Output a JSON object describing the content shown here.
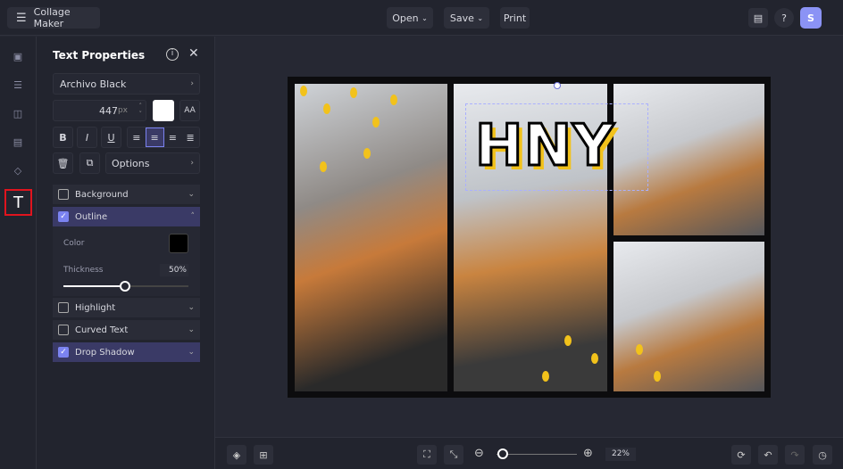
{
  "app": {
    "title": "Collage Maker",
    "menu": [
      "Open",
      "Save",
      "Print"
    ],
    "avatar": "S"
  },
  "panel": {
    "title": "Text Properties",
    "font": "Archivo Black",
    "size": "447",
    "unit": "px",
    "options": "Options",
    "sections": [
      {
        "label": "Background",
        "checked": false
      },
      {
        "label": "Outline",
        "checked": true
      },
      {
        "label": "Highlight",
        "checked": false
      },
      {
        "label": "Curved Text",
        "checked": false
      },
      {
        "label": "Drop Shadow",
        "checked": true
      }
    ],
    "outline": {
      "color_label": "Color",
      "color": "#000000",
      "thickness_label": "Thickness",
      "thickness": "50%",
      "thickness_value": 50
    }
  },
  "canvas": {
    "text": "HNY"
  },
  "bottom": {
    "zoom": "22%",
    "zoom_value": 22
  },
  "colors": {
    "accent": "#7b83f0",
    "highlight_box": "#e0141e"
  }
}
